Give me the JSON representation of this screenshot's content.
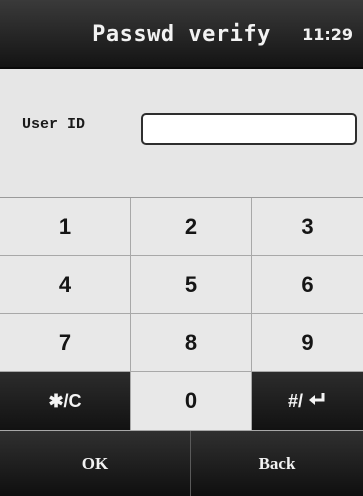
{
  "header": {
    "title": "Passwd verify",
    "time": "11:29"
  },
  "form": {
    "user_id_label": "User ID",
    "user_id_value": ""
  },
  "keypad": {
    "keys": [
      "1",
      "2",
      "3",
      "4",
      "5",
      "6",
      "7",
      "8",
      "9",
      "✱/C",
      "0",
      "#/"
    ],
    "enter_icon": "enter-return-icon"
  },
  "footer": {
    "ok_label": "OK",
    "back_label": "Back"
  },
  "colors": {
    "header_bg": "#1e1e1e",
    "body_bg": "#e6e6e6",
    "key_bg": "#e8e8e8",
    "dark_key_bg": "#1c1c1c"
  }
}
